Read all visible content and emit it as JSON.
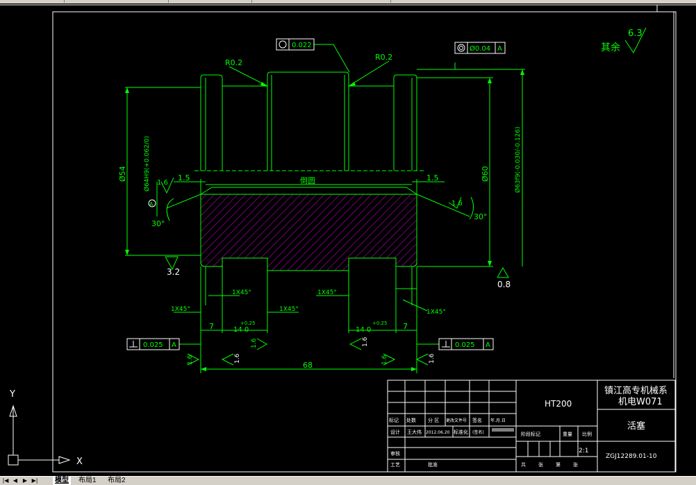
{
  "drawing": {
    "roughness_note": "其余",
    "roughness_default": "6.3",
    "tolerance_circularity": "0.022",
    "tolerance_runout": "Ø0.04",
    "datum_A": "A",
    "radius_left": "R0.2",
    "radius_right": "R0.2",
    "chamfer_label": "倒圆",
    "dim_1_5_left": "1.5",
    "dim_1_5_right": "1.5",
    "dia_54": "Ø54",
    "dia_60": "Ø60",
    "dia_63": "Ø63f9(-0.030/-0.126)",
    "dia_64": "Ø64H9(+0.062/0)",
    "roughness_1_6_left": "1.6",
    "roughness_1_6_right": "1.6",
    "angle_30_left": "30°",
    "angle_30_right": "30°",
    "roughness_3_2": "3.2",
    "roughness_0_8": "0.8",
    "chamfer_1x45_a": "1X45°",
    "chamfer_1x45_b": "1X45°",
    "chamfer_1x45_c": "1X45°",
    "chamfer_1x45_d": "1X45°",
    "chamfer_1x45_e": "1X45°",
    "dim_7_left": "7",
    "dim_7_right": "7",
    "dim_14_left": "14 0",
    "dim_14_right": "14 0",
    "tol_014_left": "+0.25",
    "tol_014_right": "+0.25",
    "perp_tol_left": "0.025",
    "perp_tol_right": "0.025",
    "roughness_bottom_1": "1.6",
    "roughness_bottom_2": "1.6",
    "roughness_bottom_3": "1.6",
    "roughness_bottom_4": "1.6",
    "roughness_bottom_5": "1.6",
    "roughness_bottom_6": "1.6",
    "dim_68": "68"
  },
  "title_block": {
    "material": "HT200",
    "school": "镇江高专机械系",
    "class_code": "机电W071",
    "part_name": "活塞",
    "drawing_no": "ZGJ12289.01-10",
    "scale": "2:1",
    "hdr_mark": "标记",
    "hdr_count": "处数",
    "hdr_zone": "分 区",
    "hdr_change_doc": "更改文件号",
    "hdr_sign": "签名",
    "hdr_date": "年.月.日",
    "design": "设计",
    "designer": "王大伟",
    "design_date": "2012.06.20",
    "standardize": "标准化",
    "sign_placeholder": "(签名)",
    "stage_mark": "阶段标记",
    "weight": "重量",
    "ratio": "比例",
    "review": "审核",
    "process": "工艺",
    "approve": "批准",
    "total": "共",
    "sheet": "张",
    "page_no": "第",
    "sheet2": "张"
  },
  "ucs": {
    "x_label": "X",
    "y_label": "Y"
  },
  "tabs": {
    "model": "模型",
    "layout1": "布局1",
    "layout2": "布局2"
  },
  "colors": {
    "lines": "#00ff00",
    "hatch": "#c000c0",
    "frame": "#ffffff",
    "background": "#000000"
  }
}
